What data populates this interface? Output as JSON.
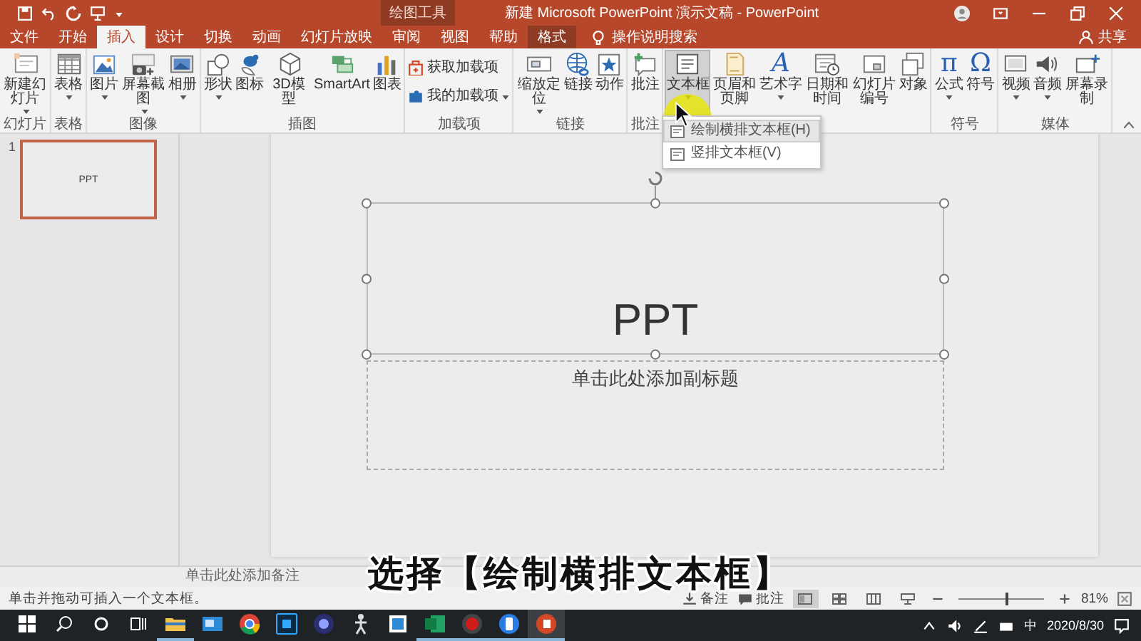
{
  "title_bar": {
    "contextual_label": "绘图工具",
    "title": "新建 Microsoft PowerPoint 演示文稿 - PowerPoint"
  },
  "tabs": [
    {
      "label": "文件",
      "selected": false,
      "contextual": false
    },
    {
      "label": "开始",
      "selected": false,
      "contextual": false
    },
    {
      "label": "插入",
      "selected": true,
      "contextual": false
    },
    {
      "label": "设计",
      "selected": false,
      "contextual": false
    },
    {
      "label": "切换",
      "selected": false,
      "contextual": false
    },
    {
      "label": "动画",
      "selected": false,
      "contextual": false
    },
    {
      "label": "幻灯片放映",
      "selected": false,
      "contextual": false
    },
    {
      "label": "审阅",
      "selected": false,
      "contextual": false
    },
    {
      "label": "视图",
      "selected": false,
      "contextual": false
    },
    {
      "label": "帮助",
      "selected": false,
      "contextual": false
    },
    {
      "label": "格式",
      "selected": false,
      "contextual": true
    }
  ],
  "tell_me": "操作说明搜索",
  "share": "共享",
  "ribbon": {
    "groups": [
      {
        "label": "幻灯片",
        "buttons": [
          {
            "label": "新建幻灯片",
            "kind": "large",
            "menu": true,
            "pressed": false
          }
        ]
      },
      {
        "label": "表格",
        "buttons": [
          {
            "label": "表格",
            "kind": "large",
            "menu": true,
            "pressed": false
          }
        ]
      },
      {
        "label": "图像",
        "buttons": [
          {
            "label": "图片",
            "kind": "large",
            "menu": true,
            "pressed": false
          },
          {
            "label": "屏幕截图",
            "kind": "large",
            "menu": true,
            "pressed": false
          },
          {
            "label": "相册",
            "kind": "large",
            "menu": true,
            "pressed": false
          }
        ]
      },
      {
        "label": "插图",
        "buttons": [
          {
            "label": "形状",
            "kind": "large",
            "menu": true,
            "pressed": false
          },
          {
            "label": "图标",
            "kind": "large",
            "menu": false,
            "pressed": false
          },
          {
            "label": "3D模型",
            "kind": "large",
            "menu": false,
            "pressed": false
          },
          {
            "label": "SmartArt",
            "kind": "large",
            "menu": false,
            "pressed": false
          },
          {
            "label": "图表",
            "kind": "large",
            "menu": false,
            "pressed": false
          }
        ]
      },
      {
        "label": "加载项",
        "buttons": [
          {
            "label": "获取加载项",
            "kind": "small",
            "menu": false,
            "pressed": false
          },
          {
            "label": "我的加载项",
            "kind": "small",
            "menu": true,
            "pressed": false
          }
        ]
      },
      {
        "label": "链接",
        "buttons": [
          {
            "label": "缩放定位",
            "kind": "large",
            "menu": true,
            "pressed": false
          },
          {
            "label": "链接",
            "kind": "large",
            "menu": false,
            "pressed": false
          },
          {
            "label": "动作",
            "kind": "large",
            "menu": false,
            "pressed": false
          }
        ]
      },
      {
        "label": "批注",
        "buttons": [
          {
            "label": "批注",
            "kind": "large",
            "menu": false,
            "pressed": false
          }
        ]
      },
      {
        "buttons": [
          {
            "label": "文本框",
            "kind": "large",
            "menu": true,
            "pressed": true
          },
          {
            "label": "页眉和页脚",
            "kind": "large",
            "menu": false,
            "pressed": false
          },
          {
            "label": "艺术字",
            "kind": "large",
            "menu": true,
            "pressed": false,
            "glyph": "A"
          },
          {
            "label": "日期和时间",
            "kind": "large",
            "menu": false,
            "pressed": false
          },
          {
            "label": "幻灯片编号",
            "kind": "large",
            "menu": false,
            "pressed": false
          },
          {
            "label": "对象",
            "kind": "large",
            "menu": false,
            "pressed": false
          }
        ]
      },
      {
        "label": "符号",
        "buttons": [
          {
            "label": "公式",
            "kind": "large",
            "menu": true,
            "pressed": false,
            "glyph": "π"
          },
          {
            "label": "符号",
            "kind": "large",
            "menu": false,
            "pressed": false,
            "glyph": "Ω"
          }
        ]
      },
      {
        "label": "媒体",
        "buttons": [
          {
            "label": "视频",
            "kind": "large",
            "menu": true,
            "pressed": false
          },
          {
            "label": "音频",
            "kind": "large",
            "menu": true,
            "pressed": false
          },
          {
            "label": "屏幕录制",
            "kind": "large",
            "menu": false,
            "pressed": false
          }
        ]
      }
    ]
  },
  "textbox_menu": {
    "items": [
      {
        "label": "绘制横排文本框(H)",
        "highlighted": true
      },
      {
        "label": "竖排文本框(V)",
        "highlighted": false
      }
    ]
  },
  "thumbnails": [
    {
      "number": "1",
      "title": "PPT",
      "selected": true
    }
  ],
  "slide": {
    "title": "PPT",
    "subtitle_placeholder": "单击此处添加副标题",
    "title_selected": true
  },
  "notes": {
    "placeholder": "单击此处添加备注"
  },
  "caption": "选择【绘制横排文本框】",
  "status_bar": {
    "message": "单击并拖动可插入一个文本框。",
    "notes": "备注",
    "comments": "批注",
    "views": [
      {
        "selected": true
      },
      {
        "selected": false
      },
      {
        "selected": false
      },
      {
        "selected": false
      }
    ],
    "zoom": {
      "level": 0.55,
      "reading": "81%"
    }
  },
  "taskbar": {
    "apps": [
      {
        "running": true,
        "active": false
      },
      {
        "running": false,
        "active": false
      },
      {
        "running": false,
        "active": false
      },
      {
        "running": false,
        "active": false
      },
      {
        "running": false,
        "active": false
      },
      {
        "running": false,
        "active": false
      },
      {
        "running": false,
        "active": false
      },
      {
        "running": true,
        "active": false
      },
      {
        "running": true,
        "active": false
      },
      {
        "running": true,
        "active": false
      },
      {
        "running": true,
        "active": true
      }
    ],
    "ime": "中",
    "date": "2020/8/30"
  }
}
